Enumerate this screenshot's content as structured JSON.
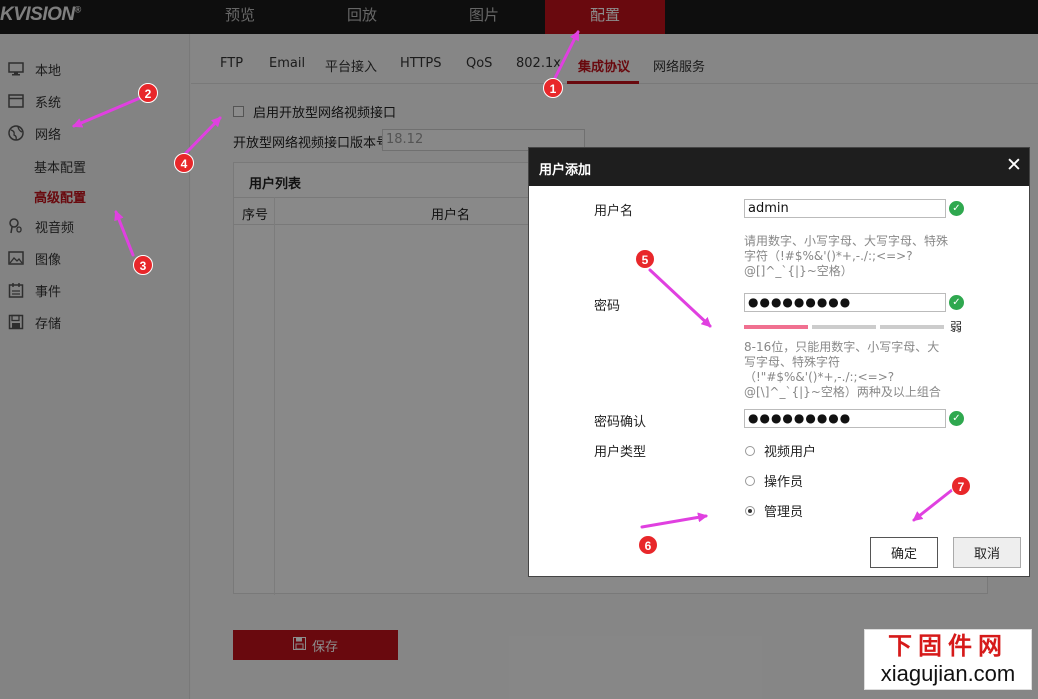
{
  "header": {
    "logo": "KVISION",
    "logo_mark": "®",
    "nav": [
      "预览",
      "回放",
      "图片",
      "配置"
    ]
  },
  "sidebar": {
    "items": [
      {
        "label": "本地",
        "icon": "monitor-icon"
      },
      {
        "label": "系统",
        "icon": "window-icon"
      },
      {
        "label": "网络",
        "icon": "globe-icon"
      },
      {
        "label": "视音频",
        "icon": "camera-mic-icon"
      },
      {
        "label": "图像",
        "icon": "image-icon"
      },
      {
        "label": "事件",
        "icon": "calendar-icon"
      },
      {
        "label": "存储",
        "icon": "storage-icon"
      }
    ],
    "network_sub": [
      "基本配置",
      "高级配置"
    ]
  },
  "tabs": [
    "FTP",
    "Email",
    "平台接入",
    "HTTPS",
    "QoS",
    "802.1x",
    "集成协议",
    "网络服务"
  ],
  "form": {
    "enable_label": "启用开放型网络视频接口",
    "version_label": "开放型网络视频接口版本号",
    "version_value": "18.12"
  },
  "user_list": {
    "title": "用户列表",
    "columns": [
      "序号",
      "用户名"
    ]
  },
  "save_label": "保存",
  "dialog": {
    "title": "用户添加",
    "close": "✕",
    "username_label": "用户名",
    "username_value": "admin",
    "username_hint": "请用数字、小写字母、大写字母、特殊字符（!#$%&'()*+,-./:;<=>?@[]^_`{|}~空格）",
    "password_label": "密码",
    "password_value": "●●●●●●●●●",
    "strength_label": "弱",
    "password_hint": "8-16位，只能用数字、小写字母、大写字母、特殊字符（!\"#$%&'()*+,-./:;<=>?@[\\]^_`{|}~空格）两种及以上组合",
    "confirm_label": "密码确认",
    "confirm_value": "●●●●●●●●●",
    "type_label": "用户类型",
    "types": [
      "视频用户",
      "操作员",
      "管理员"
    ],
    "selected_type": "管理员",
    "ok_label": "确定",
    "cancel_label": "取消"
  },
  "annotations": [
    "1",
    "2",
    "3",
    "4",
    "5",
    "6",
    "7"
  ],
  "watermark": {
    "line1": "下固件网",
    "line2": "xiagujian.com"
  },
  "colors": {
    "accent": "#c0121a",
    "annotation": "#e8272a",
    "arrow": "#e040e0",
    "ok": "#2fa84f"
  }
}
